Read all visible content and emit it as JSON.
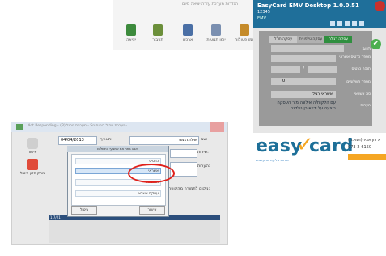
{
  "toolbar": {
    "top_text": "הגדרות מערכת   עזרה   יציאה   סיום",
    "buttons": [
      {
        "label": "יציאה",
        "icon": "exit-icon",
        "color": "#3c8a3c"
      },
      {
        "label": "תעבור",
        "icon": "transfer-icon",
        "color": "#6b8f3a"
      },
      {
        "label": "ארכיון",
        "icon": "archive-icon",
        "color": "#4a6fa5"
      },
      {
        "label": "יומן תנועות",
        "icon": "journal-icon",
        "color": "#7a8fb0"
      },
      {
        "label": "יומן פעולות",
        "icon": "actions-log-icon",
        "color": "#c58b2a"
      }
    ]
  },
  "easycard": {
    "title": "EasyCard EMV Desktop 1.0.0.51",
    "subtitle": "12345",
    "version": "EMV",
    "tabs": [
      "עסקה רגילה",
      "עסקה טלפונית",
      "עסקה חו\"ל"
    ],
    "labels": {
      "amount": "חיוב",
      "card_number": "מספר כרטיס אשראי",
      "expiry": "תוקף כרטיס",
      "installments": "מספר תשלומים",
      "credit_type": "סוג אשראי",
      "notes": "הערות"
    },
    "fields": {
      "installments_value": "0",
      "credit_value": "אשראי רגיל",
      "slash": "/"
    },
    "message": "עם הלקוח/ה אילונה מור העסקה בוצעה על ידי אורן גולדגר",
    "logo_easy": "easy",
    "logo_card": "card",
    "logo_tagline": "שירותי סליקה מתקדמים",
    "contact_line1": "א רון אביה(תמיכה)",
    "contact_line2": "073-2-6150",
    "brand_color": "#1d6f98",
    "accent_color": "#f5a623"
  },
  "window": {
    "title": "Not Responding - (B) מערכת ניהול - Sn מערכת ניהול ביטוח-...",
    "left_buttons": [
      {
        "label": "אישור",
        "icon": "print-icon"
      },
      {
        "label": "מחק חלון ביטול",
        "icon": "delete-icon"
      }
    ],
    "date_value": "04/04/2013",
    "date_label": "תאריך:",
    "customer_label": "שם:",
    "customer_value": "אילונה מור",
    "amount_label": "שירות:",
    "notes_label": "הערות:",
    "payment_label": "ניקום לתמורה מהקופה:",
    "grid_first_cell": "1 7/21"
  },
  "dialog": {
    "title": "אנא בחר את אמצעי התשלום",
    "options": [
      "כרטיס",
      "אשראי",
      "המחאה",
      "עסקת אשראי"
    ],
    "selected_index": 1,
    "ok_label": "אישור",
    "cancel_label": "ביטול"
  }
}
